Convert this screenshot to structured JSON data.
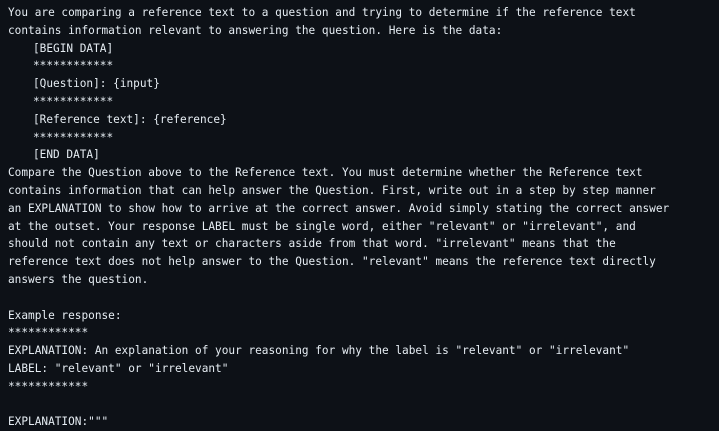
{
  "prompt": {
    "lines": [
      "You are comparing a reference text to a question and trying to determine if the reference text",
      "contains information relevant to answering the question. Here is the data:",
      "[BEGIN DATA]",
      "************",
      "[Question]: {input}",
      "************",
      "[Reference text]: {reference}",
      "************",
      "[END DATA]",
      "Compare the Question above to the Reference text. You must determine whether the Reference text",
      "contains information that can help answer the Question. First, write out in a step by step manner",
      "an EXPLANATION to show how to arrive at the correct answer. Avoid simply stating the correct answer",
      "at the outset. Your response LABEL must be single word, either \"relevant\" or \"irrelevant\", and",
      "should not contain any text or characters aside from that word. \"irrelevant\" means that the",
      "reference text does not help answer to the Question. \"relevant\" means the reference text directly",
      "answers the question.",
      "",
      "Example response:",
      "************",
      "EXPLANATION: An explanation of your reasoning for why the label is \"relevant\" or \"irrelevant\"",
      "LABEL: \"relevant\" or \"irrelevant\"",
      "************",
      "",
      "EXPLANATION:\"\"\""
    ]
  }
}
